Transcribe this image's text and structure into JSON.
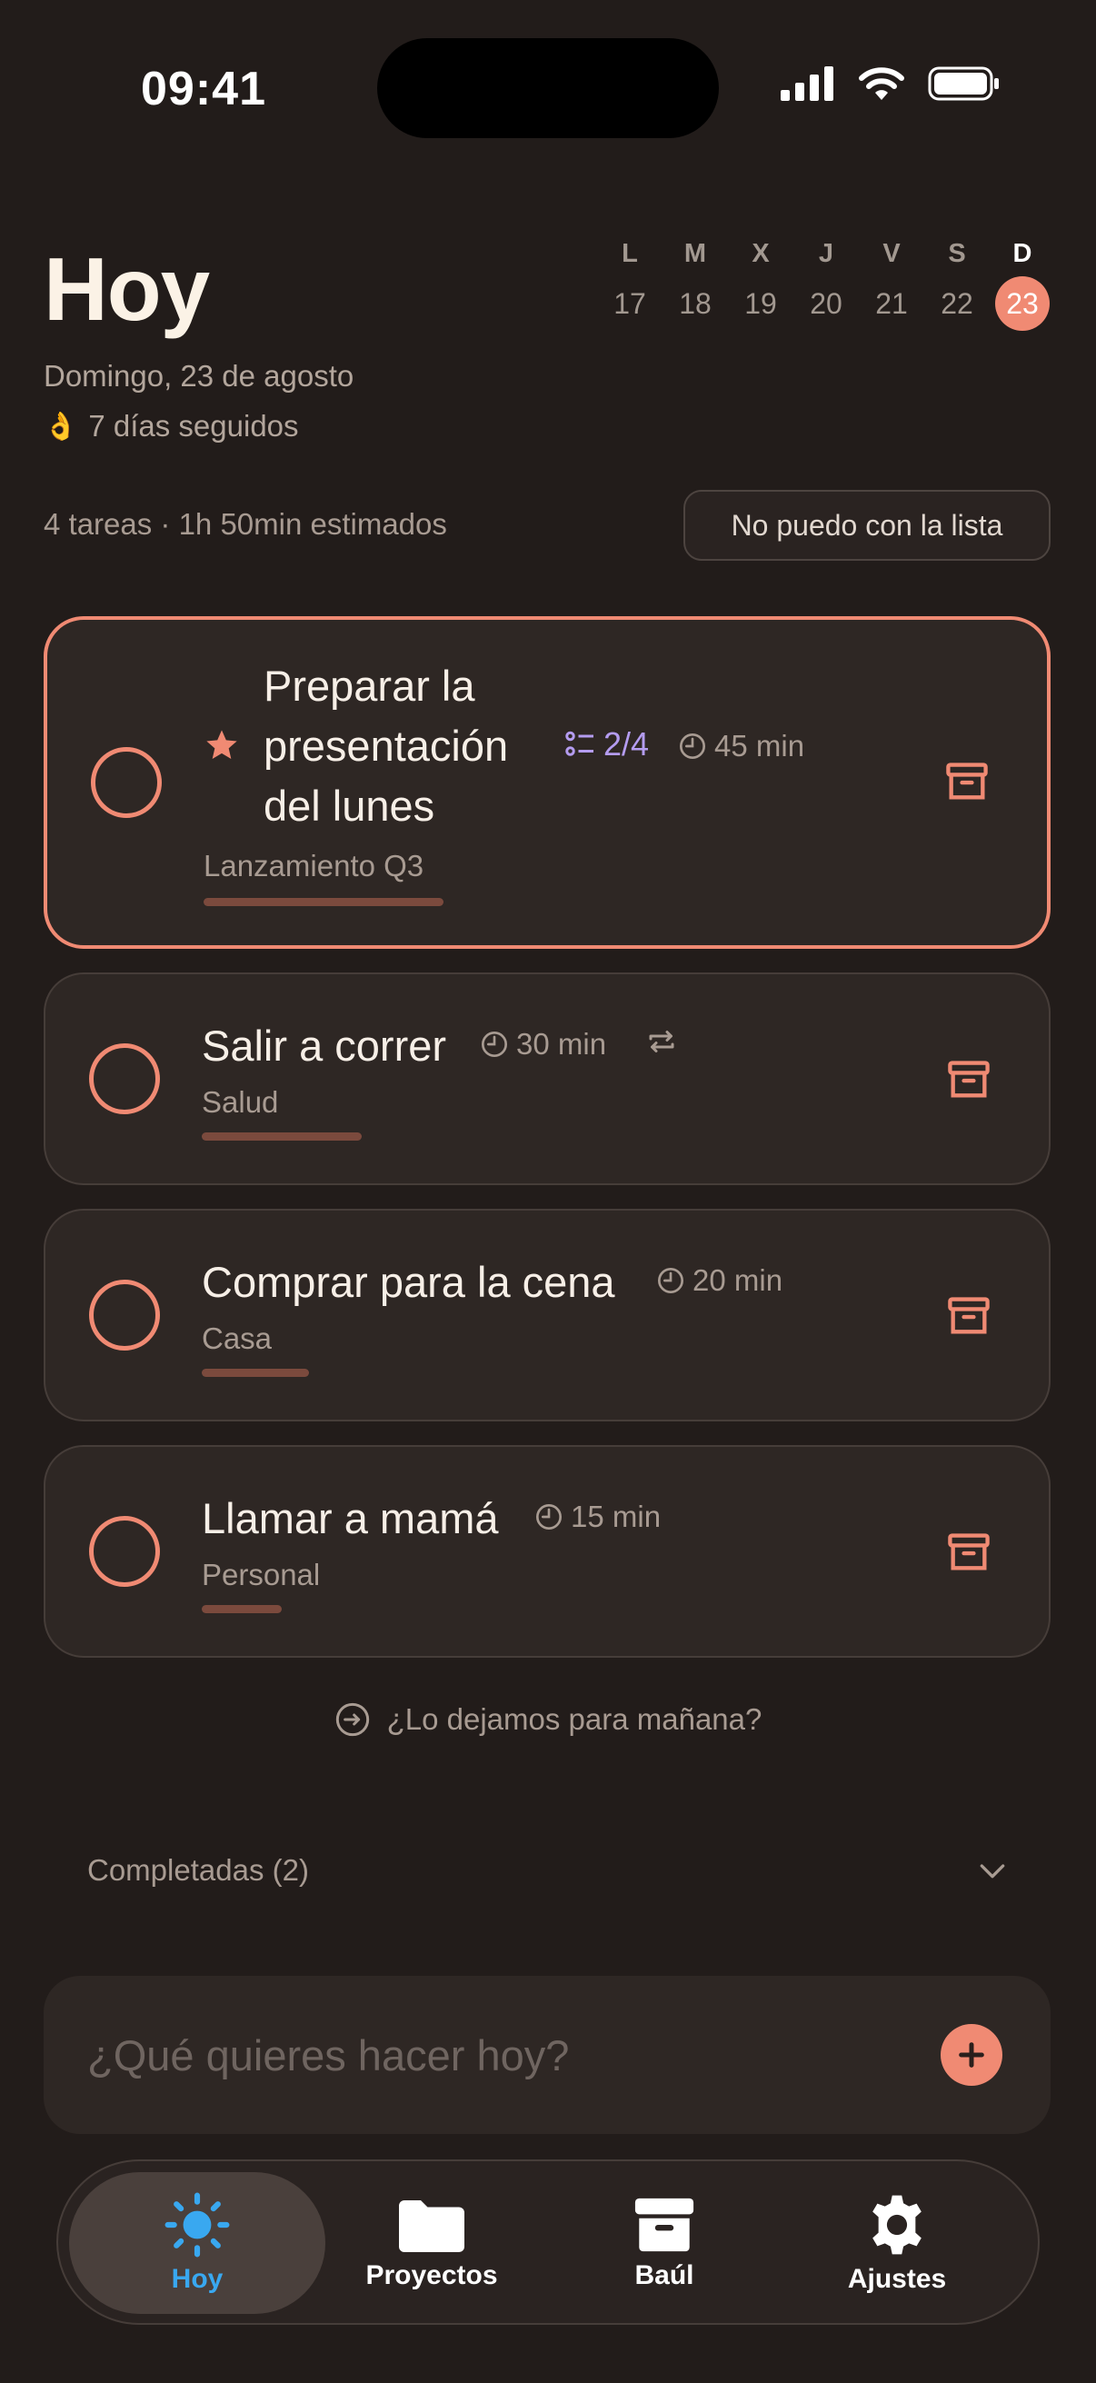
{
  "status": {
    "time": "09:41"
  },
  "header": {
    "title": "Hoy",
    "date": "Domingo, 23 de agosto",
    "streak_emoji": "👌",
    "streak": "7 días seguidos"
  },
  "week": [
    {
      "letter": "L",
      "num": "17"
    },
    {
      "letter": "M",
      "num": "18"
    },
    {
      "letter": "X",
      "num": "19"
    },
    {
      "letter": "J",
      "num": "20"
    },
    {
      "letter": "V",
      "num": "21"
    },
    {
      "letter": "S",
      "num": "22"
    },
    {
      "letter": "D",
      "num": "23",
      "today": true
    }
  ],
  "summary": "4 tareas · 1h 50min estimados",
  "overwhelm_button": "No puedo con la lista",
  "tasks": [
    {
      "title": "Preparar la presentación del lunes",
      "subtasks": "2/4",
      "duration": "45 min",
      "project": "Lanzamiento Q3",
      "starred": true
    },
    {
      "title": "Salir a correr",
      "duration": "30 min",
      "project": "Salud",
      "repeat": true
    },
    {
      "title": "Comprar para la cena",
      "duration": "20 min",
      "project": "Casa"
    },
    {
      "title": "Llamar a mamá",
      "duration": "15 min",
      "project": "Personal"
    }
  ],
  "postpone": "¿Lo dejamos para mañana?",
  "completed": "Completadas (2)",
  "composer": {
    "placeholder": "¿Qué quieres hacer hoy?"
  },
  "tabs": [
    {
      "label": "Hoy",
      "icon": "sun-icon",
      "active": true
    },
    {
      "label": "Proyectos",
      "icon": "folder-icon"
    },
    {
      "label": "Baúl",
      "icon": "archive-icon"
    },
    {
      "label": "Ajustes",
      "icon": "gear-icon"
    }
  ],
  "colors": {
    "accent": "#f08a73",
    "background": "#221c1a",
    "card": "#2e2724",
    "active_tab": "#39a8f0",
    "subtask": "#b49cf0"
  }
}
